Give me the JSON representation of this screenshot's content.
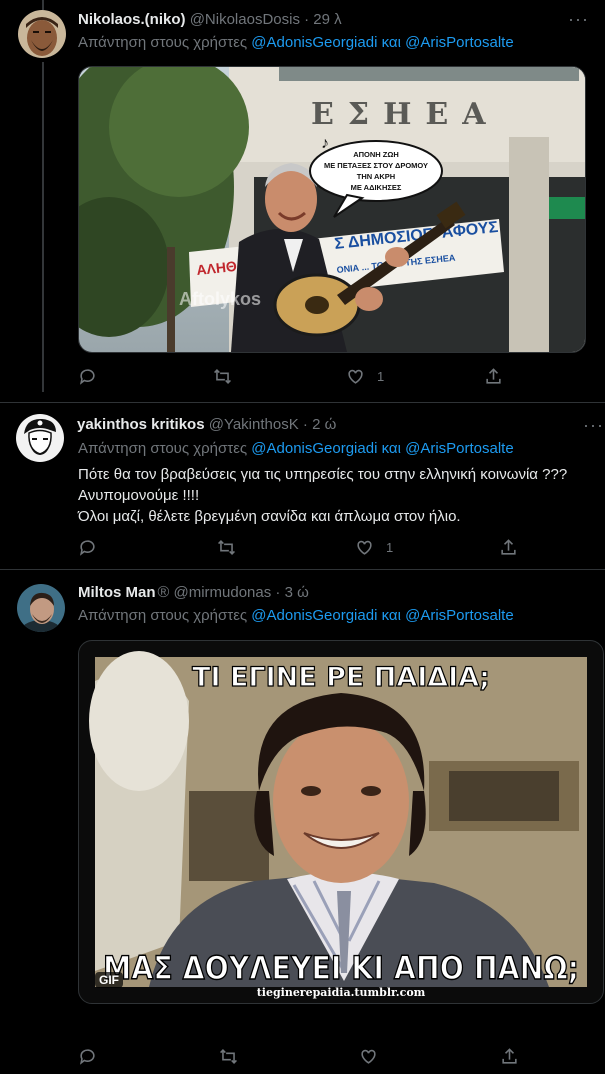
{
  "tweets": [
    {
      "name": "Nikolaos.(niko)",
      "handle": "@NikolaosDosis",
      "time": "29 λ",
      "reply_prefix": "Απάντηση στους χρήστες",
      "mentions": [
        "@AdonisGeorgiadi",
        "και",
        "@ArisPortosalte"
      ],
      "media": {
        "kind": "photo",
        "building_sign": "ΕΣΗΕΑ",
        "speech_bubble": [
          "ΑΠΟΝΗ ΖΩΗ",
          "ΜΕ ΠΕΤΑΞΕΣ ΣΤΟΥ ΔΡΟΜΟΥ",
          "ΤΗΝ ΑΚΡΗ",
          "ΜΕ ΑΔΙΚΗΣΕΣ"
        ],
        "banner": "Σ ΔΗΜΟΣΙΟΓΡΑΦΟΥΣ",
        "banner_sub": "ΑΛΗΘ",
        "banner_small": "ΟΝΙΑ ... ΤΟ Δ.Σ. ΤΗΣ ΕΣΗΕΑ",
        "watermark": "Aftolykos"
      },
      "actions": {
        "reply": "",
        "retweet": "",
        "like": "1",
        "share": ""
      }
    },
    {
      "name": "yakinthos kritikos",
      "handle": "@YakinthosK",
      "time": "2 ώ",
      "reply_prefix": "Απάντηση στους χρήστες",
      "mentions": [
        "@AdonisGeorgiadi",
        "και",
        "@ArisPortosalte"
      ],
      "lines": [
        "Πότε θα τον βραβεύσεις για τις υπηρεσίες του στην ελληνική κοινωνία ???",
        "Ανυπομονούμε !!!!",
        "Όλοι μαζί, θέλετε βρεγμένη σανίδα και άπλωμα στον ήλιο."
      ],
      "actions": {
        "reply": "",
        "retweet": "",
        "like": "1",
        "share": ""
      }
    },
    {
      "name": "Miltos Man",
      "name_suffix": "®",
      "handle": "@mirmudonas",
      "time": "3 ώ",
      "reply_prefix": "Απάντηση στους χρήστες",
      "mentions": [
        "@AdonisGeorgiadi",
        "και",
        "@ArisPortosalte"
      ],
      "media": {
        "kind": "gif",
        "top_caption": "ΤΙ ΕΓΙΝΕ ΡΕ ΠΑΙΔΙΑ;",
        "bottom_caption": "ΜΑΣ ΔΟΥΛΕΥΕΙ ΚΙ ΑΠΟ ΠΑΝΩ;",
        "gif_badge": "GIF",
        "source": "tieginerepaidia.tumblr.com"
      },
      "actions": {
        "reply": "",
        "retweet": "",
        "like": "",
        "share": ""
      }
    }
  ],
  "colors": {
    "background": "#000000",
    "text": "#e7e9ea",
    "secondary": "#71767b",
    "link": "#1d9bf0",
    "divider": "#2f3336"
  }
}
